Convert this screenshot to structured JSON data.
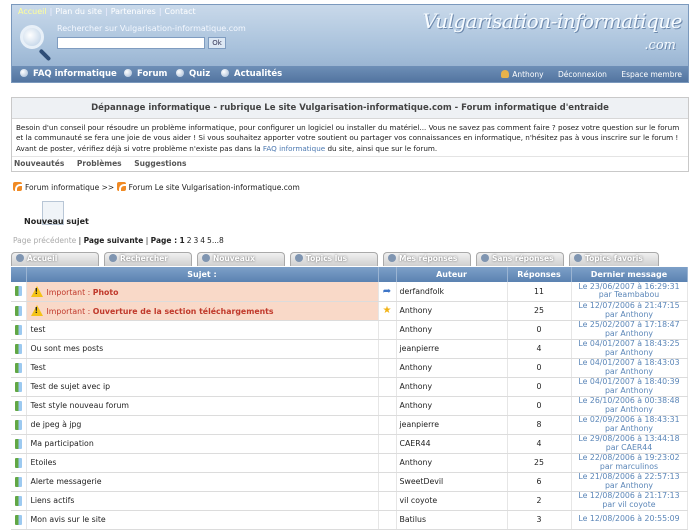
{
  "topnav": {
    "home": "Accueil",
    "sitemap": "Plan du site",
    "partners": "Partenaires",
    "contact": "Contact",
    "sep": "|"
  },
  "search": {
    "label": "Rechercher sur Vulgarisation-informatique.com",
    "placeholder": "",
    "value": "",
    "button": "Ok"
  },
  "logo": {
    "text": "Vulgarisation-informatique",
    "suffix": ".com"
  },
  "mainnav": [
    {
      "label": "FAQ informatique"
    },
    {
      "label": "Forum"
    },
    {
      "label": "Quiz"
    },
    {
      "label": "Actualités"
    }
  ],
  "usernav": {
    "user": "Anthony",
    "logout": "Déconnexion",
    "member_space": "Espace membre"
  },
  "intro": {
    "title": "Dépannage informatique - rubrique Le site Vulgarisation-informatique.com - Forum informatique d'entraide",
    "text_before": "Besoin d'un conseil pour résoudre un problème informatique, pour configurer un logiciel ou installer du matériel... Vous ne savez pas comment faire ? posez votre question sur le forum et la communauté se fera une joie de vous aider ! Si vous souhaitez apporter votre soutient ou partager vos connaissances en informatique, n'hésitez pas à vous inscrire sur le forum ! Avant de poster, vérifiez déjà si votre problème n'existe pas dans la ",
    "link": "FAQ informatique",
    "text_after": " du site, ainsi que sur le forum.",
    "tabs": [
      "Nouveautés",
      "Problèmes",
      "Suggestions"
    ]
  },
  "breadcrumb": {
    "forum": "Forum informatique",
    "sep": ">>",
    "section": "Forum Le site Vulgarisation-informatique.com"
  },
  "new_topic": {
    "label": "Nouveau sujet"
  },
  "pagination": {
    "prev": "Page précédente",
    "sep": "|",
    "next": "Page suivante",
    "page_label": "Page :",
    "current": "1",
    "pages": [
      "2",
      "3",
      "4",
      "5"
    ],
    "ellipsis": "...",
    "last": "8"
  },
  "tabs": [
    {
      "label": "Accueil"
    },
    {
      "label": "Rechercher"
    },
    {
      "label": "Nouveaux"
    },
    {
      "label": "Topics lus"
    },
    {
      "label": "Mes réponses"
    },
    {
      "label": "Sans réponses"
    },
    {
      "label": "Topics favoris"
    }
  ],
  "table": {
    "headers": {
      "subject": "Sujet :",
      "author": "Auteur",
      "replies": "Réponses",
      "last": "Dernier message"
    },
    "rows": [
      {
        "important": true,
        "label": "Important :",
        "subject": "Photo",
        "mark": "arrow",
        "author": "derfandfolk",
        "replies": "11",
        "last_date": "Le 23/06/2007 à 16:29:31",
        "last_by": "par Teambabou"
      },
      {
        "important": true,
        "label": "Important :",
        "subject": "Ouverture de la section téléchargements",
        "mark": "star",
        "author": "Anthony",
        "replies": "25",
        "last_date": "Le 12/07/2006 à 21:47:15",
        "last_by": "par Anthony"
      },
      {
        "important": false,
        "subject": "test",
        "mark": "",
        "author": "Anthony",
        "replies": "0",
        "last_date": "Le 25/02/2007 à 17:18:47",
        "last_by": "par Anthony"
      },
      {
        "important": false,
        "subject": "Ou sont mes posts",
        "mark": "",
        "author": "jeanpierre",
        "replies": "4",
        "last_date": "Le 04/01/2007 à 18:43:25",
        "last_by": "par Anthony"
      },
      {
        "important": false,
        "subject": "Test",
        "mark": "",
        "author": "Anthony",
        "replies": "0",
        "last_date": "Le 04/01/2007 à 18:43:03",
        "last_by": "par Anthony"
      },
      {
        "important": false,
        "subject": "Test de sujet avec ip",
        "mark": "",
        "author": "Anthony",
        "replies": "0",
        "last_date": "Le 04/01/2007 à 18:40:39",
        "last_by": "par Anthony"
      },
      {
        "important": false,
        "subject": "Test style nouveau forum",
        "mark": "",
        "author": "Anthony",
        "replies": "0",
        "last_date": "Le 26/10/2006 à 00:38:48",
        "last_by": "par Anthony"
      },
      {
        "important": false,
        "subject": "de jpeg à jpg",
        "mark": "",
        "author": "jeanpierre",
        "replies": "8",
        "last_date": "Le 02/09/2006 à 18:43:31",
        "last_by": "par Anthony"
      },
      {
        "important": false,
        "subject": "Ma participation",
        "mark": "",
        "author": "CAER44",
        "replies": "4",
        "last_date": "Le 29/08/2006 à 13:44:18",
        "last_by": "par CAER44"
      },
      {
        "important": false,
        "subject": "Etoiles",
        "mark": "",
        "author": "Anthony",
        "replies": "25",
        "last_date": "Le 22/08/2006 à 19:23:02",
        "last_by": "par marculinos"
      },
      {
        "important": false,
        "subject": "Alerte messagerie",
        "mark": "",
        "author": "SweetDevil",
        "replies": "6",
        "last_date": "Le 21/08/2006 à 22:57:13",
        "last_by": "par Anthony"
      },
      {
        "important": false,
        "subject": "Liens actifs",
        "mark": "",
        "author": "vil coyote",
        "replies": "2",
        "last_date": "Le 12/08/2006 à 21:17:13",
        "last_by": "par vil coyote"
      },
      {
        "important": false,
        "subject": "Mon avis sur le site",
        "mark": "",
        "author": "Batilus",
        "replies": "3",
        "last_date": "Le 12/08/2006 à 20:55:09",
        "last_by": ""
      }
    ]
  }
}
